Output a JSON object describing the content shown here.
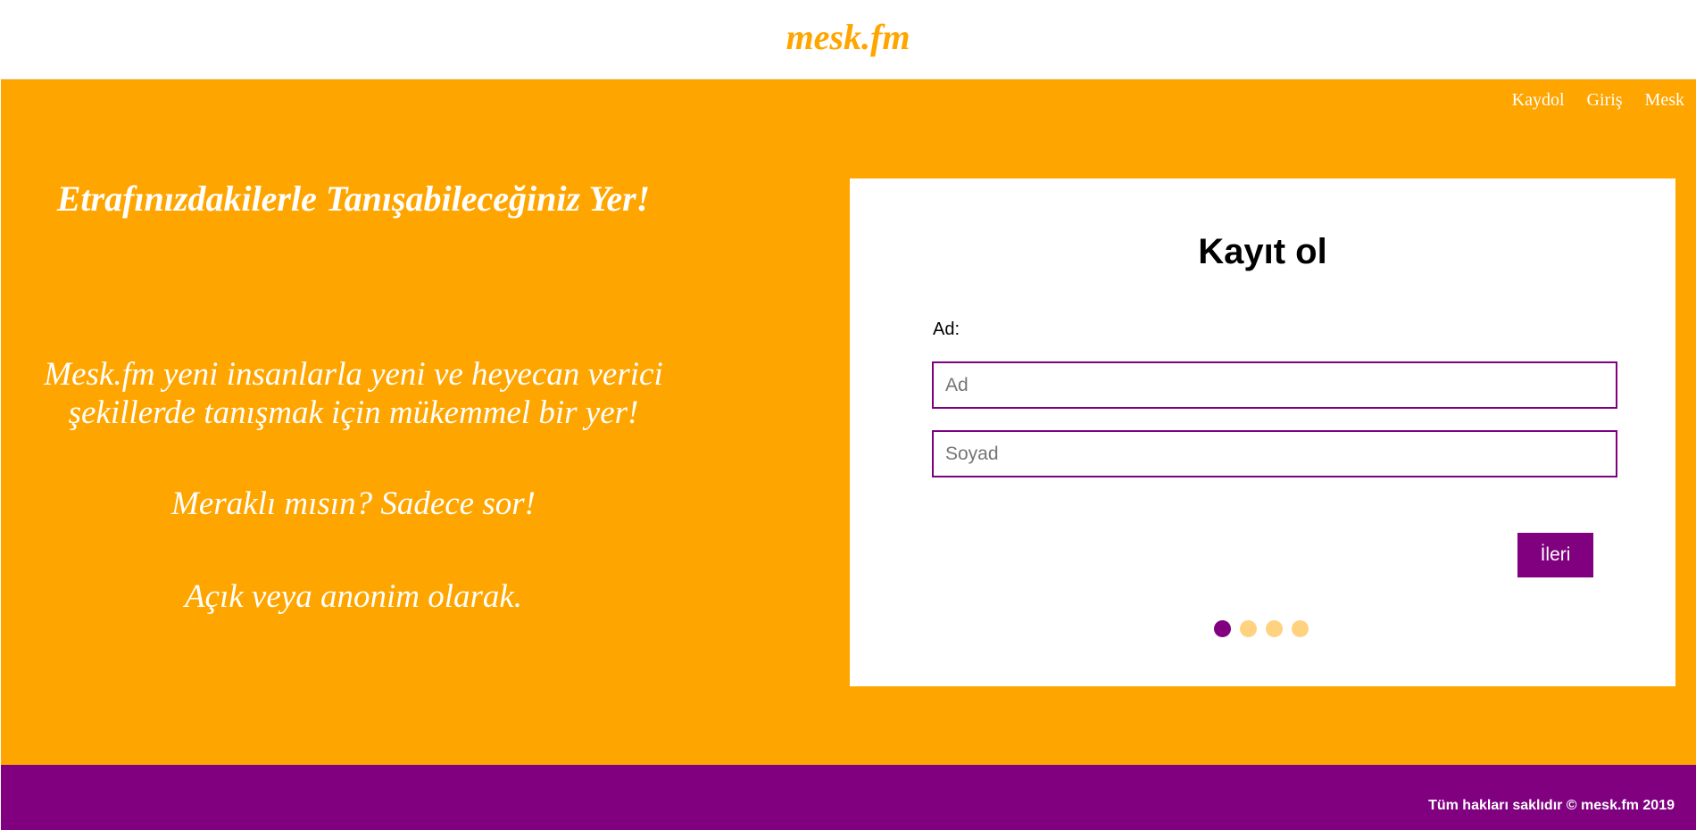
{
  "header": {
    "brand": "mesk.fm"
  },
  "nav": {
    "items": [
      {
        "label": "Kaydol"
      },
      {
        "label": "Giriş"
      },
      {
        "label": "Mesk"
      }
    ]
  },
  "hero": {
    "headline": "Etrafınızdakilerle Tanışabileceğiniz Yer!",
    "description_1": "Mesk.fm yeni insanlarla yeni ve heyecan verici şekillerde tanışmak için mükemmel bir yer!",
    "description_2": "Meraklı mısın? Sadece sor!",
    "description_3": "Açık veya anonim olarak."
  },
  "signup": {
    "title": "Kayıt ol",
    "field_label": "Ad:",
    "first_name": {
      "value": "",
      "placeholder": "Ad"
    },
    "last_name": {
      "value": "",
      "placeholder": "Soyad"
    },
    "next_label": "İleri",
    "steps_total": 4,
    "current_step": 1
  },
  "footer": {
    "copyright": "Tüm hakları saklıdır © mesk.fm 2019"
  },
  "colors": {
    "brand": "#ffa500",
    "accent": "#800080",
    "background": "#ffffff"
  }
}
